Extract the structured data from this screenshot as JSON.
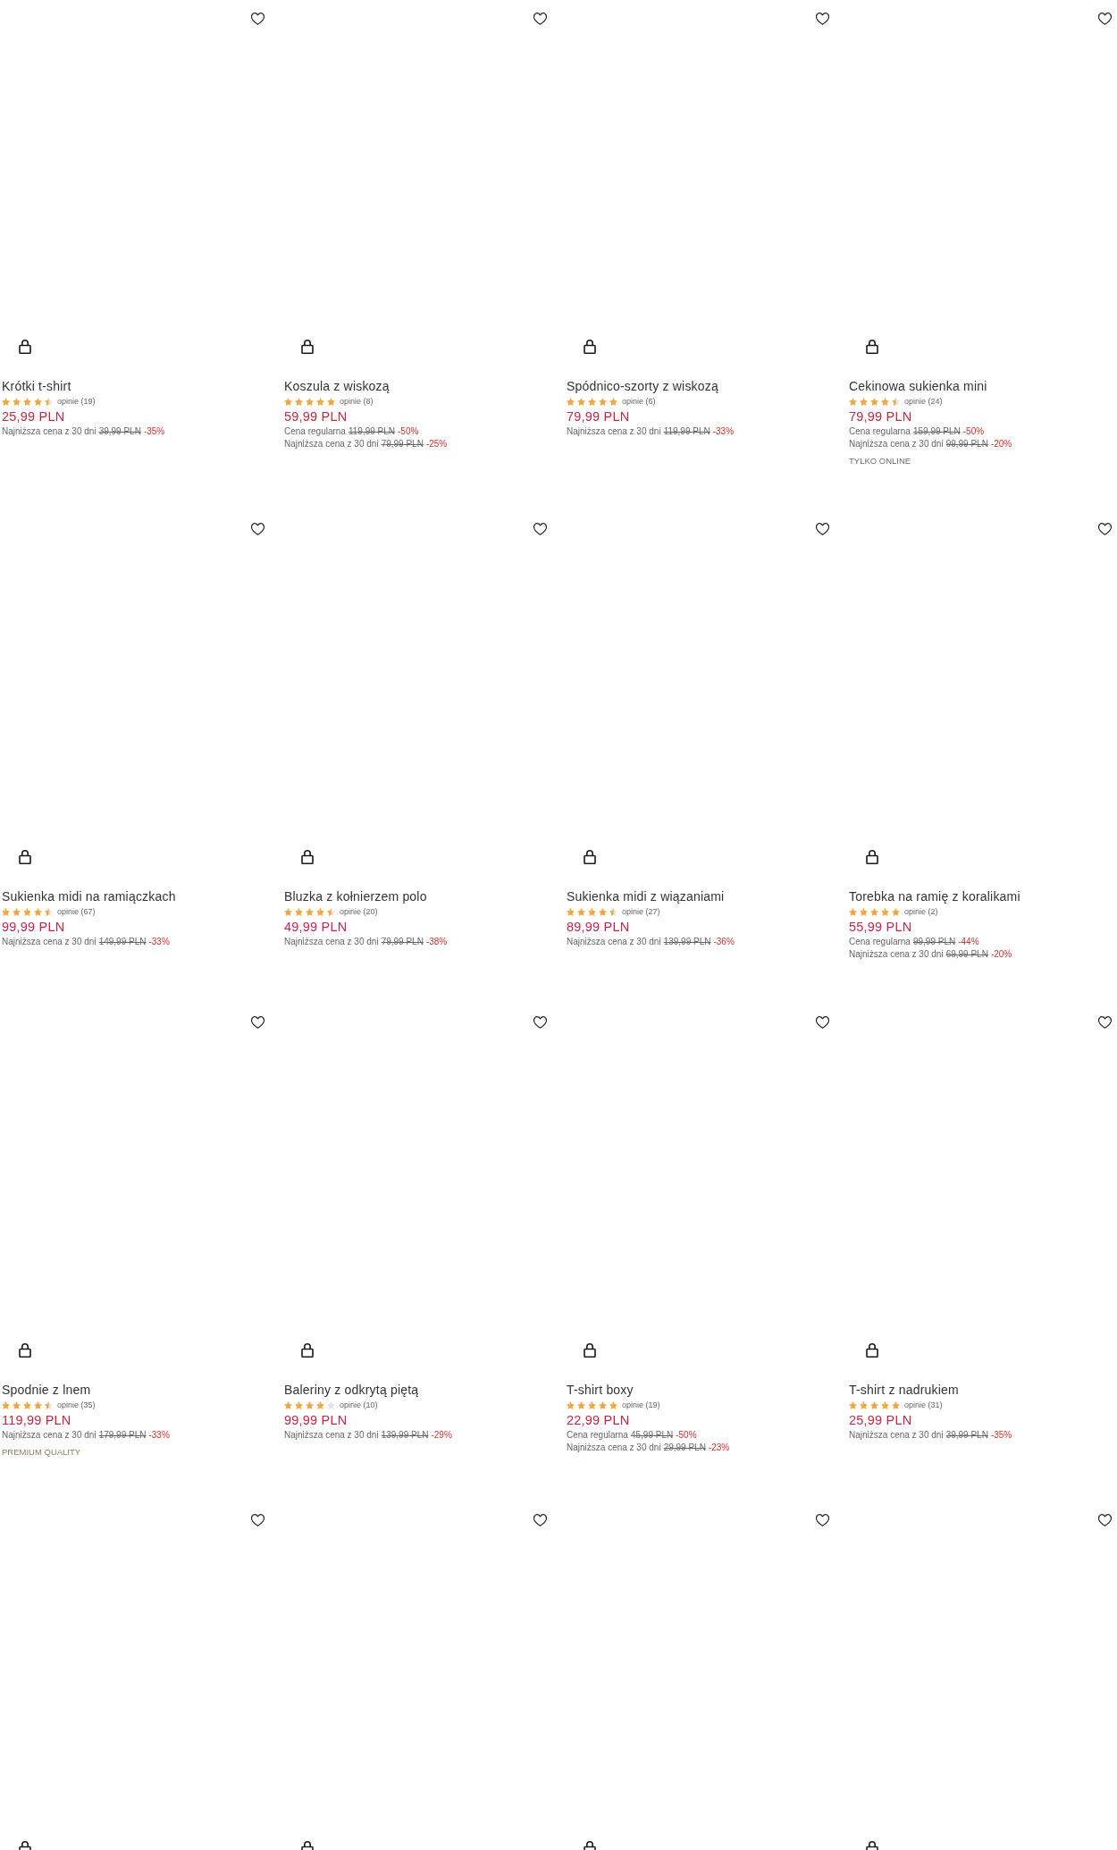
{
  "products": [
    {
      "name": "Krótki t-shirt",
      "rating": {
        "stars": 4.5,
        "reviews": "opinie (19)"
      },
      "price": "25,99 PLN",
      "price_notes": [
        {
          "label": "Najniższa cena z 30 dni",
          "old_price": "39,99 PLN",
          "discount": "-35%"
        }
      ],
      "favorite": false
    },
    {
      "name": "Koszula z wiskozą",
      "rating": {
        "stars": 5,
        "reviews": "opinie (8)"
      },
      "price": "59,99 PLN",
      "price_notes": [
        {
          "label": "Cena regularna",
          "old_price": "119,99 PLN",
          "discount": "-50%"
        },
        {
          "label": "Najniższa cena z 30 dni",
          "old_price": "79,99 PLN",
          "discount": "-25%"
        }
      ],
      "favorite": false
    },
    {
      "name": "Spódnico-szorty z wiskozą",
      "rating": {
        "stars": 5,
        "reviews": "opinie (6)"
      },
      "price": "79,99 PLN",
      "price_notes": [
        {
          "label": "Najniższa cena z 30 dni",
          "old_price": "119,99 PLN",
          "discount": "-33%"
        }
      ],
      "favorite": false
    },
    {
      "name": "Cekinowa sukienka mini",
      "rating": {
        "stars": 4.5,
        "reviews": "opinie (24)"
      },
      "price": "79,99 PLN",
      "price_notes": [
        {
          "label": "Cena regularna",
          "old_price": "159,99 PLN",
          "discount": "-50%"
        },
        {
          "label": "Najniższa cena z 30 dni",
          "old_price": "99,99 PLN",
          "discount": "-20%"
        }
      ],
      "tag": {
        "text": "TYLKO ONLINE",
        "color": "#6e6e6e"
      },
      "favorite": false
    },
    {
      "name": "Sukienka midi na ramiączkach",
      "rating": {
        "stars": 4.5,
        "reviews": "opinie (67)"
      },
      "price": "99,99 PLN",
      "price_notes": [
        {
          "label": "Najniższa cena z 30 dni",
          "old_price": "149,99 PLN",
          "discount": "-33%"
        }
      ],
      "favorite": false
    },
    {
      "name": "Bluzka z kołnierzem polo",
      "rating": {
        "stars": 4.5,
        "reviews": "opinie (20)"
      },
      "price": "49,99 PLN",
      "price_notes": [
        {
          "label": "Najniższa cena z 30 dni",
          "old_price": "79,99 PLN",
          "discount": "-38%"
        }
      ],
      "favorite": false
    },
    {
      "name": "Sukienka midi z wiązaniami",
      "rating": {
        "stars": 4.5,
        "reviews": "opinie (27)"
      },
      "price": "89,99 PLN",
      "price_notes": [
        {
          "label": "Najniższa cena z 30 dni",
          "old_price": "139,99 PLN",
          "discount": "-36%"
        }
      ],
      "favorite": false
    },
    {
      "name": "Torebka na ramię z koralikami",
      "rating": {
        "stars": 5,
        "reviews": "opinie (2)"
      },
      "price": "55,99 PLN",
      "price_notes": [
        {
          "label": "Cena regularna",
          "old_price": "99,99 PLN",
          "discount": "-44%"
        },
        {
          "label": "Najniższa cena z 30 dni",
          "old_price": "69,99 PLN",
          "discount": "-20%"
        }
      ],
      "favorite": false
    },
    {
      "name": "Spodnie z lnem",
      "rating": {
        "stars": 4.5,
        "reviews": "opinie (35)"
      },
      "price": "119,99 PLN",
      "price_notes": [
        {
          "label": "Najniższa cena z 30 dni",
          "old_price": "179,99 PLN",
          "discount": "-33%"
        }
      ],
      "tag": {
        "text": "PREMIUM QUALITY",
        "color": "#8a7d66"
      },
      "favorite": false
    },
    {
      "name": "Baleriny z odkrytą piętą",
      "rating": {
        "stars": 4,
        "reviews": "opinie (10)"
      },
      "price": "99,99 PLN",
      "price_notes": [
        {
          "label": "Najniższa cena z 30 dni",
          "old_price": "139,99 PLN",
          "discount": "-29%"
        }
      ],
      "favorite": false
    },
    {
      "name": "T-shirt boxy",
      "rating": {
        "stars": 5,
        "reviews": "opinie (19)"
      },
      "price": "22,99 PLN",
      "price_notes": [
        {
          "label": "Cena regularna",
          "old_price": "45,99 PLN",
          "discount": "-50%"
        },
        {
          "label": "Najniższa cena z 30 dni",
          "old_price": "29,99 PLN",
          "discount": "-23%"
        }
      ],
      "favorite": false
    },
    {
      "name": "T-shirt z nadrukiem",
      "rating": {
        "stars": 5,
        "reviews": "opinie (31)"
      },
      "price": "25,99 PLN",
      "price_notes": [
        {
          "label": "Najniższa cena z 30 dni",
          "old_price": "39,99 PLN",
          "discount": "-35%"
        }
      ],
      "favorite": false
    },
    {
      "favorite": false
    },
    {
      "favorite": false
    },
    {
      "favorite": false
    },
    {
      "favorite": false
    }
  ]
}
